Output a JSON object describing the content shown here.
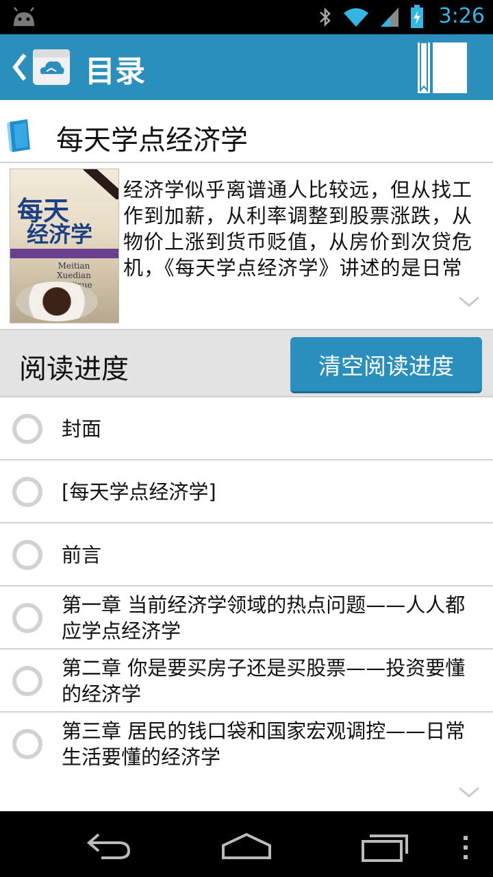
{
  "status_bar": {
    "time": "3:26",
    "icons": [
      "android-icon",
      "bluetooth-icon",
      "wifi-icon",
      "signal-icon",
      "battery-charging-icon"
    ],
    "accent": "#33b5e5"
  },
  "action_bar": {
    "title": "目录",
    "bg": "#2a8fbd",
    "icons": [
      "back-chevron-icon",
      "cloud-book-app-icon",
      "bookmark-icon"
    ]
  },
  "book": {
    "title": "每天学点经济学",
    "description": "经济学似乎离谱通人比较远，但从找工作到加薪，从利率调整到股票涨跌，从物价上涨到货币贬值，从房价到次贷危机，《每天学点经济学》讲述的是日常生活中的道理，适合普通人阅读。",
    "cover": {
      "line1": "每天",
      "line2": "经济学",
      "line3": "Meitian Xuedian Jingjixue"
    }
  },
  "progress": {
    "label": "阅读进度",
    "clear_button": "清空阅读进度"
  },
  "toc": [
    {
      "label": "封面"
    },
    {
      "label": "[每天学点经济学]"
    },
    {
      "label": "前言"
    },
    {
      "label": "第一章 当前经济学领域的热点问题——人人都应学点经济学"
    },
    {
      "label": "第二章 你是要买房子还是买股票——投资要懂的经济学"
    },
    {
      "label": "第三章 居民的钱口袋和国家宏观调控——日常生活要懂的经济学"
    }
  ],
  "nav_bar": {
    "icons": [
      "back-nav-icon",
      "home-nav-icon",
      "recents-nav-icon",
      "overflow-menu-icon"
    ]
  }
}
